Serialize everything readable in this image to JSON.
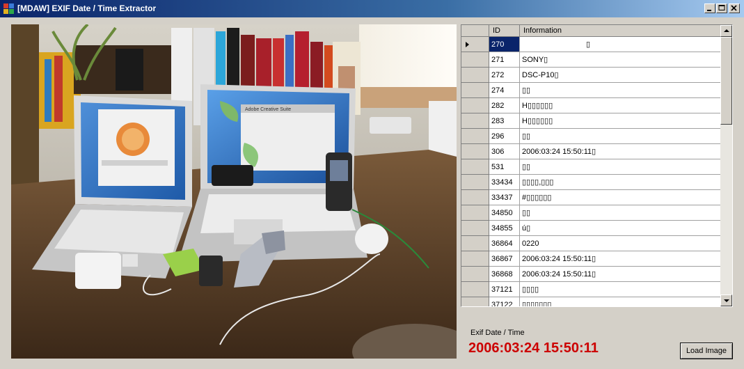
{
  "window": {
    "title": "[MDAW] EXIF Date / Time Extractor",
    "icon_colors": [
      "#d83a2a",
      "#3a7ad8",
      "#e0b020",
      "#2ea84a"
    ]
  },
  "photo": {
    "screen_texts": [
      "Adobe Creative Suite"
    ]
  },
  "grid": {
    "columns": {
      "id": "ID",
      "info": "Information"
    },
    "rows": [
      {
        "id": "270",
        "info": "▯",
        "selected": true
      },
      {
        "id": "271",
        "info": "SONY▯"
      },
      {
        "id": "272",
        "info": "DSC-P10▯"
      },
      {
        "id": "274",
        "info": "▯▯"
      },
      {
        "id": "282",
        "info": "H▯▯▯▯▯▯"
      },
      {
        "id": "283",
        "info": "H▯▯▯▯▯▯"
      },
      {
        "id": "296",
        "info": "▯▯"
      },
      {
        "id": "306",
        "info": "2006:03:24 15:50:11▯"
      },
      {
        "id": "531",
        "info": "▯▯"
      },
      {
        "id": "33434",
        "info": "▯▯▯▯,▯▯▯"
      },
      {
        "id": "33437",
        "info": "#▯▯▯▯▯▯"
      },
      {
        "id": "34850",
        "info": "▯▯"
      },
      {
        "id": "34855",
        "info": "ú▯"
      },
      {
        "id": "36864",
        "info": "0220"
      },
      {
        "id": "36867",
        "info": "2006:03:24 15:50:11▯"
      },
      {
        "id": "36868",
        "info": "2006:03:24 15:50:11▯"
      },
      {
        "id": "37121",
        "info": "▯▯▯▯"
      },
      {
        "id": "37122",
        "info": "▯▯▯▯▯▯▯"
      }
    ]
  },
  "exif": {
    "label": "Exif Date / Time",
    "value": "2006:03:24 15:50:11",
    "value_color": "#cc0000"
  },
  "buttons": {
    "load": "Load Image"
  }
}
